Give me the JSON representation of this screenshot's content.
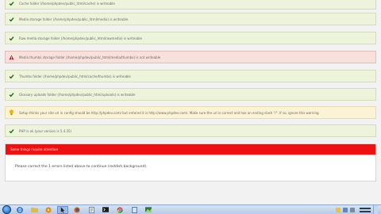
{
  "checks": [
    {
      "status": "ok",
      "icon": "check-icon",
      "text": "Cache folder (/home/phpdev/public_html/cache) is writeable"
    },
    {
      "status": "ok",
      "icon": "check-icon",
      "text": "Media storage folder (/home/phpdev/public_html/media) is writeable"
    },
    {
      "status": "ok",
      "icon": "check-icon",
      "text": "Raw media storage folder (/home/phpdev/public_html/rawmedia) is writeable"
    },
    {
      "status": "error",
      "icon": "warning-triangle-icon",
      "text": "Media thumbs storage folder (/home/phpdev/public_html/media/thumbs) is not writeable"
    },
    {
      "status": "ok",
      "icon": "check-icon",
      "text": "Thumbs folder (/home/phpdev/public_html/cache/thumbs) is writeable"
    },
    {
      "status": "ok",
      "icon": "check-icon",
      "text": "Glossary uploads folder (/home/phpdev/public_html/uploads) is writeable"
    },
    {
      "status": "warning",
      "icon": "lightbulb-icon",
      "text": "Setup thinks your site url in config should be http://phpdev.com/ but entered it is http://www.phpdev.com/. Make sure the url is correct and has an ending slash \"/\". If so, ignore this warning."
    },
    {
      "status": "ok",
      "icon": "check-icon",
      "text": "PHP is ok (your version is 5.4.35)"
    }
  ],
  "alert": {
    "title": "Some things require attention",
    "message": "Please correct the 1 errors listed above to continue (reddish background).",
    "color": "#ee1111"
  },
  "colors": {
    "ok_bg": "#eef4dc",
    "error_bg": "#f8e0dc",
    "warning_bg": "#fbf3d6"
  },
  "taskbar": {
    "items": [
      {
        "icon": "start-orb-icon"
      },
      {
        "icon": "ie-browser-icon"
      },
      {
        "icon": "file-explorer-icon"
      },
      {
        "icon": "media-player-icon"
      },
      {
        "icon": "cursor-app-icon",
        "active": true
      },
      {
        "icon": "firefox-icon"
      },
      {
        "icon": "document-app-icon"
      },
      {
        "icon": "terminal-icon"
      },
      {
        "icon": "chrome-icon"
      },
      {
        "icon": "notepad-icon"
      },
      {
        "icon": "photo-app-icon"
      }
    ],
    "tray_icons": [
      "flag-icon",
      "network-icon",
      "volume-icon"
    ]
  }
}
